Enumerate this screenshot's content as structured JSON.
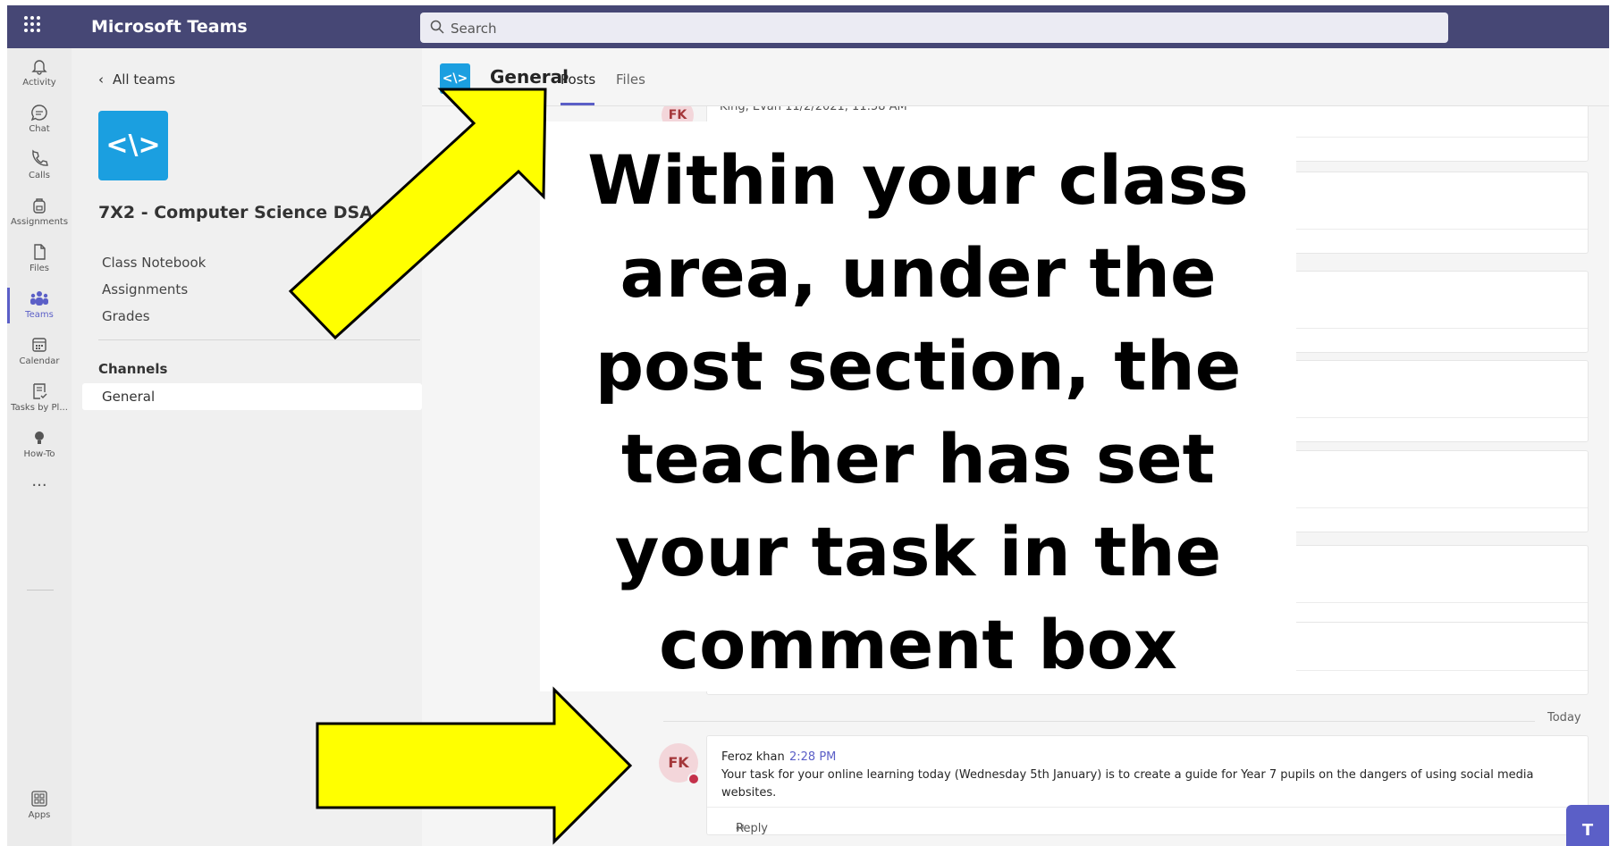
{
  "app": {
    "title": "Microsoft Teams",
    "search_placeholder": "Search"
  },
  "rail": {
    "items": [
      {
        "label": "Activity",
        "icon": "bell-icon"
      },
      {
        "label": "Chat",
        "icon": "chat-icon"
      },
      {
        "label": "Calls",
        "icon": "phone-icon"
      },
      {
        "label": "Assignments",
        "icon": "backpack-icon"
      },
      {
        "label": "Files",
        "icon": "file-icon"
      },
      {
        "label": "Teams",
        "icon": "teams-icon",
        "active": true
      },
      {
        "label": "Calendar",
        "icon": "calendar-icon"
      },
      {
        "label": "Tasks by Pl...",
        "icon": "tasks-icon"
      },
      {
        "label": "How-To",
        "icon": "lightbulb-icon"
      }
    ],
    "more": "...",
    "apps_label": "Apps"
  },
  "team_panel": {
    "back_label": "All teams",
    "team_icon_text": "<\\>",
    "team_name": "7X2 - Computer Science DSA",
    "links": [
      "Class Notebook",
      "Assignments",
      "Grades"
    ],
    "channels_heading": "Channels",
    "channels": [
      "General"
    ]
  },
  "channel": {
    "icon_text": "<\\>",
    "name": "General",
    "tabs": [
      "Posts",
      "Files"
    ],
    "active_tab": "Posts"
  },
  "feed": {
    "top_post": {
      "avatar": "FK",
      "meta": "King, Evan   11/2/2021, 11:58 AM"
    },
    "divider_label": "Today",
    "post": {
      "avatar": "FK",
      "author": "Feroz khan",
      "time": "2:28 PM",
      "text": "Your task for your online learning today (Wednesday 5th January) is to create a guide for Year 7 pupils on the dangers of using social media websites.",
      "reply_label": "Reply"
    },
    "corner_badge": "T"
  },
  "annotation": {
    "text": "Within your class area, under the post section, the teacher has set your task in the comment box",
    "arrow_color": "#ffff00"
  }
}
